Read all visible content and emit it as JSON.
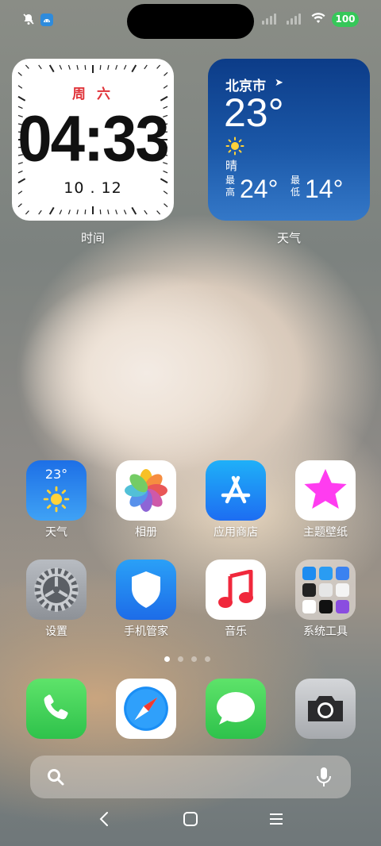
{
  "status_bar": {
    "battery": "100"
  },
  "clock_widget": {
    "day": "周 六",
    "time": "04:33",
    "date": "10 . 12",
    "label": "时间"
  },
  "weather_widget": {
    "city": "北京市",
    "temp": "23°",
    "condition": "晴",
    "high_label": "最高",
    "high": "24°",
    "low_label": "最低",
    "low": "14°",
    "label": "天气"
  },
  "apps": [
    {
      "label": "天气",
      "badge": "23°"
    },
    {
      "label": "相册"
    },
    {
      "label": "应用商店"
    },
    {
      "label": "主题壁纸"
    },
    {
      "label": "设置"
    },
    {
      "label": "手机管家"
    },
    {
      "label": "音乐"
    },
    {
      "label": "系统工具"
    }
  ],
  "dock": [
    "phone-icon",
    "safari-icon",
    "messages-icon",
    "camera-icon"
  ],
  "page_indicator": {
    "pages": 4,
    "current": 1
  },
  "colors": {
    "battery": "#36c759",
    "clock_day": "#e0343a",
    "weather_bg": "#1b58a8"
  }
}
